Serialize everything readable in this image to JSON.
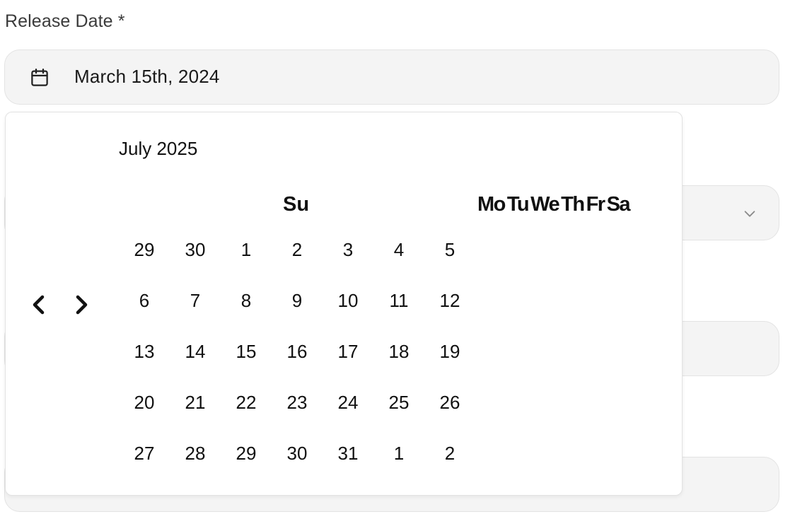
{
  "form": {
    "release_date_label": "Release Date *",
    "release_date_value": "March 15th, 2024"
  },
  "calendar": {
    "month_caption": "July 2025",
    "weekday_first": "Su",
    "weekdays_rest": [
      "Mo",
      "Tu",
      "We",
      "Th",
      "Fr",
      "Sa"
    ],
    "weeks": [
      [
        "29",
        "30",
        "1",
        "2",
        "3",
        "4",
        "5"
      ],
      [
        "6",
        "7",
        "8",
        "9",
        "10",
        "11",
        "12"
      ],
      [
        "13",
        "14",
        "15",
        "16",
        "17",
        "18",
        "19"
      ],
      [
        "20",
        "21",
        "22",
        "23",
        "24",
        "25",
        "26"
      ],
      [
        "27",
        "28",
        "29",
        "30",
        "31",
        "1",
        "2"
      ]
    ],
    "prev_icon": "chevron-left-icon",
    "next_icon": "chevron-right-icon"
  },
  "icons": {
    "date_field": "calendar-icon",
    "select_field": "chevron-down-icon"
  }
}
